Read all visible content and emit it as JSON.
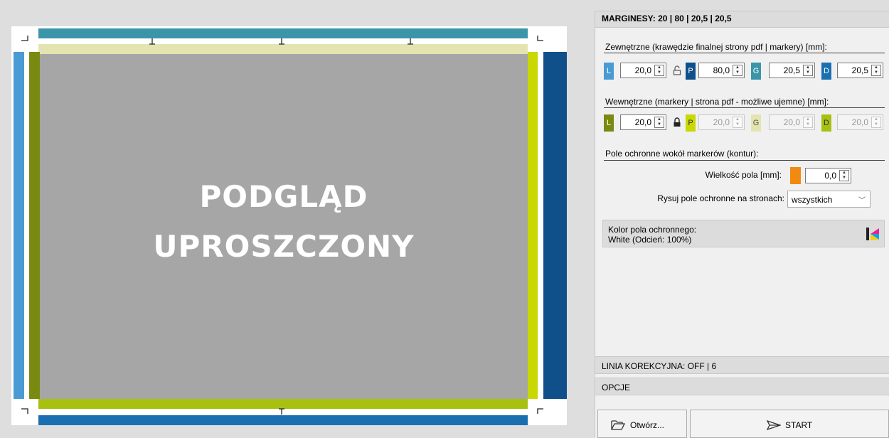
{
  "preview": {
    "title_line1": "PODGLĄD",
    "title_line2": "UPROSZCZONY"
  },
  "panel": {
    "header": "MARGINESY: 20 | 80 | 20,5 | 20,5",
    "outer": {
      "label": "Zewnętrzne (krawędzie finalnej strony pdf | markery) [mm]:",
      "fields": [
        {
          "letter": "L",
          "value": "20,0",
          "color": "#4a9bd4"
        },
        {
          "letter": "P",
          "value": "80,0",
          "color": "#10508a"
        },
        {
          "letter": "G",
          "value": "20,5",
          "color": "#3a95a8"
        },
        {
          "letter": "D",
          "value": "20,5",
          "color": "#1a6fb0"
        }
      ],
      "lock_icon": "unlocked-padlock-icon"
    },
    "inner": {
      "label": "Wewnętrzne (markery | strona pdf - możliwe ujemne) [mm]:",
      "fields": [
        {
          "letter": "L",
          "value": "20,0",
          "color": "#7a8a10"
        },
        {
          "letter": "P",
          "value": "20,0",
          "color": "#c8d800"
        },
        {
          "letter": "G",
          "value": "20,0",
          "color": "#e4e4b0"
        },
        {
          "letter": "D",
          "value": "20,0",
          "color": "#a8c010"
        }
      ],
      "lock_icon": "locked-padlock-icon"
    },
    "protect": {
      "label": "Pole ochronne wokół markerów (kontur):",
      "size_label": "Wielkość pola [mm]:",
      "size_value": "0,0",
      "size_color": "#f08a10",
      "draw_label": "Rysuj pole ochronne na stronach:",
      "draw_value": "wszystkich"
    },
    "color_box": {
      "line1": "Kolor pola ochronnego:",
      "line2": "White (Odcień: 100%)",
      "icon": "color-picker-icon"
    },
    "correction_header": "LINIA KOREKCYJNA: OFF | 6",
    "options_header": "OPCJE"
  },
  "buttons": {
    "open_label": "Otwórz...",
    "start_label": "START"
  }
}
